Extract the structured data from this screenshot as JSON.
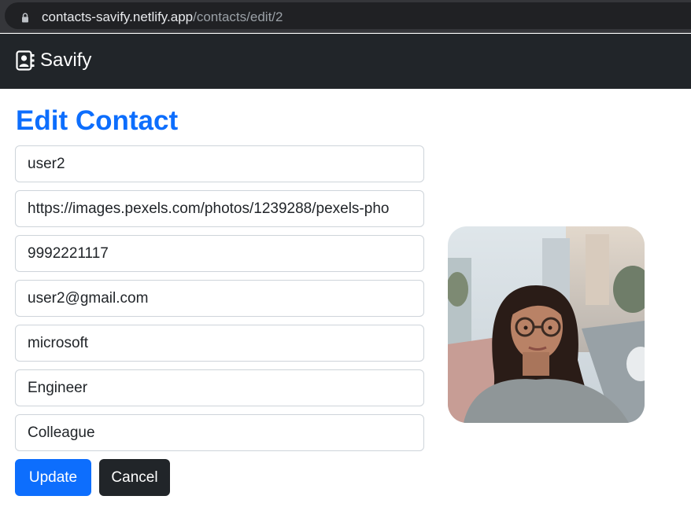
{
  "browser": {
    "url_domain": "contacts-savify.netlify.app",
    "url_path": "/contacts/edit/2"
  },
  "navbar": {
    "brand": "Savify",
    "brand_icon": "contact-book-icon"
  },
  "page": {
    "title": "Edit Contact"
  },
  "form": {
    "name": "user2",
    "photo_url": "https://images.pexels.com/photos/1239288/pexels-pho",
    "mobile": "9992221117",
    "email": "user2@gmail.com",
    "company": "microsoft",
    "title": "Engineer",
    "group": "Colleague"
  },
  "buttons": {
    "update": "Update",
    "cancel": "Cancel"
  },
  "colors": {
    "primary": "#0d6efd",
    "dark": "#212529"
  }
}
